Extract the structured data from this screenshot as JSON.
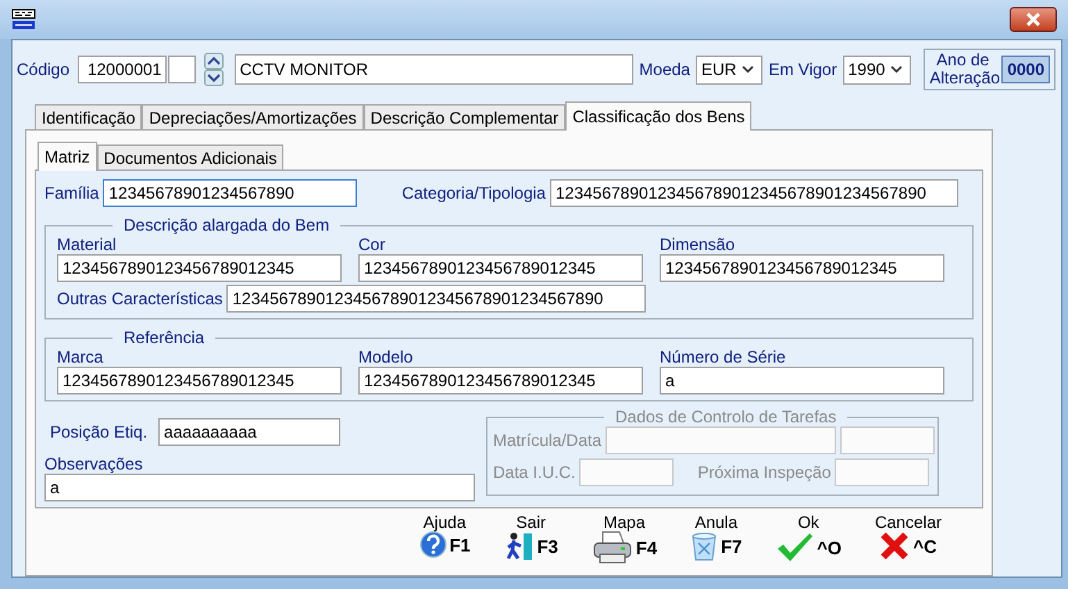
{
  "header": {
    "code_label": "Código",
    "code": "12000001",
    "description": "CCTV MONITOR",
    "currency_label": "Moeda",
    "currency": "EUR",
    "valid_label": "Em Vigor",
    "valid_year": "1990",
    "change_year_label": "Ano de Alteração",
    "change_year": "0000"
  },
  "tabs": [
    {
      "label": "Identificação",
      "selected": false
    },
    {
      "label": "Depreciações/Amortizações",
      "selected": false
    },
    {
      "label": "Descrição Complementar",
      "selected": false
    },
    {
      "label": "Classificação dos Bens",
      "selected": true
    }
  ],
  "subtabs": [
    {
      "label": "Matriz",
      "selected": true
    },
    {
      "label": "Documentos Adicionais",
      "selected": false
    }
  ],
  "familia": {
    "label": "Família",
    "value": "12345678901234567890"
  },
  "categoria": {
    "label": "Categoria/Tipologia",
    "value": "1234567890123456789012345678901234567890"
  },
  "descricao": {
    "title": "Descrição alargada do Bem",
    "material": {
      "label": "Material",
      "value": "1234567890123456789012345"
    },
    "cor": {
      "label": "Cor",
      "value": "1234567890123456789012345"
    },
    "dimensao": {
      "label": "Dimensão",
      "value": "1234567890123456789012345"
    },
    "outras": {
      "label": "Outras Características",
      "value": "1234567890123456789012345678901234567890"
    }
  },
  "referencia": {
    "title": "Referência",
    "marca": {
      "label": "Marca",
      "value": "1234567890123456789012345"
    },
    "modelo": {
      "label": "Modelo",
      "value": "1234567890123456789012345"
    },
    "serie": {
      "label": "Número de Série",
      "value": "a"
    }
  },
  "posicao": {
    "label": "Posição Etiq.",
    "value": "aaaaaaaaaa"
  },
  "observacoes": {
    "label": "Observações",
    "value": "a"
  },
  "tarefas": {
    "title": "Dados de Controlo de Tarefas",
    "disabled": true,
    "matricula_label": "Matrícula/Data",
    "iuc_label": "Data I.U.C.",
    "inspecao_label": "Próxima Inspeção"
  },
  "actions": [
    {
      "kind": "help",
      "label": "Ajuda",
      "key": "F1"
    },
    {
      "kind": "exit",
      "label": "Sair",
      "key": "F3"
    },
    {
      "kind": "print",
      "label": "Mapa",
      "key": "F4"
    },
    {
      "kind": "cancel-doc",
      "label": "Anula",
      "key": "F7"
    },
    {
      "kind": "ok",
      "label": "Ok",
      "key": "^O"
    },
    {
      "kind": "cancel",
      "label": "Cancelar",
      "key": "^C"
    }
  ]
}
